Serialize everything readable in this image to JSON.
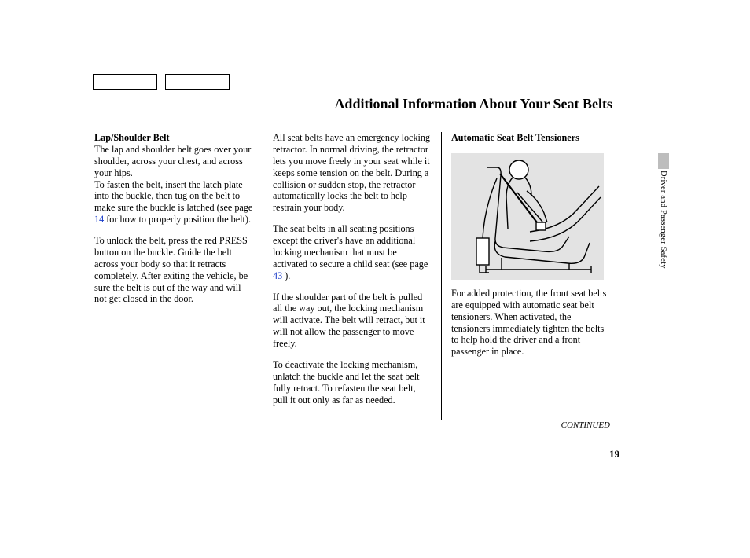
{
  "page_title": "Additional Information About Your Seat Belts",
  "side_label": "Driver and Passenger Safety",
  "continued": "CONTINUED",
  "page_number": "19",
  "col1": {
    "h1": "Lap/Shoulder Belt",
    "p1": "The lap and shoulder belt goes over your shoulder, across your chest, and across your hips.",
    "p2a": "To fasten the belt, insert the latch plate into the buckle, then tug on the belt to make sure the buckle is latched (see page ",
    "p2_link": "14",
    "p2b": " for how to properly position the belt).",
    "p3": "To unlock the belt, press the red PRESS button on the buckle. Guide the belt across your body so that it retracts completely. After exiting the vehicle, be sure the belt is out of the way and will not get closed in the door."
  },
  "col2": {
    "p1": "All seat belts have an emergency locking retractor. In normal driving, the retractor lets you move freely in your seat while it keeps some tension on the belt. During a collision or sudden stop, the retractor automatically locks the belt to help restrain your body.",
    "p2a": "The seat belts in all seating positions except the driver's have an additional locking mechanism that must be activated to secure a child seat (see page ",
    "p2_link": "43",
    "p2b": " ).",
    "p3": "If the shoulder part of the belt is pulled all the way out, the locking mechanism will activate. The belt will retract, but it will not allow the passenger to move freely.",
    "p4": "To deactivate the locking mechanism, unlatch the buckle and let the seat belt fully retract. To refasten the seat belt, pull it out only as far as needed."
  },
  "col3": {
    "h1": "Automatic Seat Belt Tensioners",
    "p1": "For added protection, the front seat belts are equipped with automatic seat belt tensioners. When activated, the tensioners immediately tighten the belts to help hold the driver and a front passenger in place."
  }
}
